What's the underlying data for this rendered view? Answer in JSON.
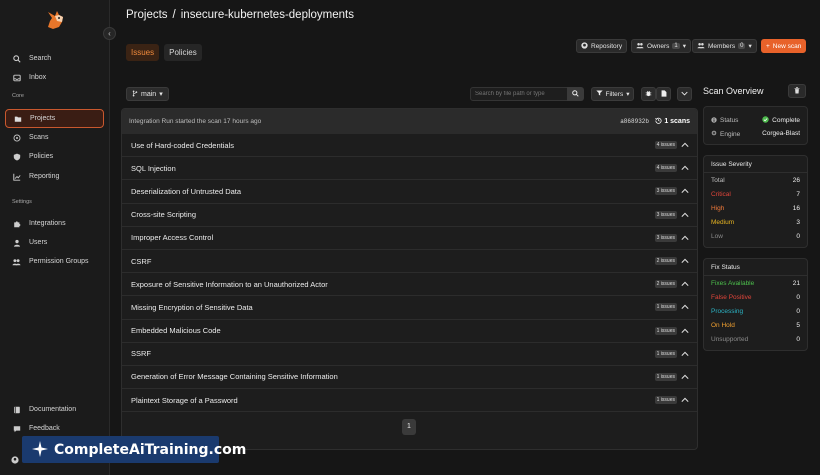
{
  "sidebar": {
    "items_top": [
      {
        "label": "Search",
        "icon": "search-icon"
      },
      {
        "label": "Inbox",
        "icon": "inbox-icon"
      }
    ],
    "section_core": "Core",
    "items_core": [
      {
        "label": "Projects",
        "icon": "folder-icon"
      },
      {
        "label": "Scans",
        "icon": "radar-icon"
      },
      {
        "label": "Policies",
        "icon": "shield-icon"
      },
      {
        "label": "Reporting",
        "icon": "chart-icon"
      }
    ],
    "section_settings": "Settings",
    "items_settings": [
      {
        "label": "Integrations",
        "icon": "puzzle-icon"
      },
      {
        "label": "Users",
        "icon": "user-icon"
      },
      {
        "label": "Permission Groups",
        "icon": "users-icon"
      }
    ],
    "items_bottom": [
      {
        "label": "Documentation",
        "icon": "book-icon"
      },
      {
        "label": "Feedback",
        "icon": "chat-icon"
      }
    ]
  },
  "breadcrumb": {
    "root": "Projects",
    "sep": "/",
    "project": "insecure-kubernetes-deployments"
  },
  "tabs": [
    "Issues",
    "Policies"
  ],
  "header_buttons": {
    "repository": "Repository",
    "owners": "Owners",
    "owners_count": "1",
    "members": "Members",
    "members_count": "0",
    "new_scan": "New scan"
  },
  "toolbar": {
    "branch": "main",
    "search_placeholder": "Search by file path or type",
    "filters": "Filters"
  },
  "scan_info": {
    "message": "Integration Run started the scan 17 hours ago",
    "commit": "a868932b",
    "scans": "1 scans"
  },
  "issues": [
    {
      "title": "Use of Hard-coded Credentials",
      "count": "4 issues"
    },
    {
      "title": "SQL Injection",
      "count": "4 issues"
    },
    {
      "title": "Deserialization of Untrusted Data",
      "count": "3 issues"
    },
    {
      "title": "Cross-site Scripting",
      "count": "3 issues"
    },
    {
      "title": "Improper Access Control",
      "count": "3 issues"
    },
    {
      "title": "CSRF",
      "count": "2 issues"
    },
    {
      "title": "Exposure of Sensitive Information to an Unauthorized Actor",
      "count": "2 issues"
    },
    {
      "title": "Missing Encryption of Sensitive Data",
      "count": "1 issues"
    },
    {
      "title": "Embedded Malicious Code",
      "count": "1 issues"
    },
    {
      "title": "SSRF",
      "count": "1 issues"
    },
    {
      "title": "Generation of Error Message Containing Sensitive Information",
      "count": "1 issues"
    },
    {
      "title": "Plaintext Storage of a Password",
      "count": "1 issues"
    }
  ],
  "pagination": {
    "current": "1"
  },
  "overview": {
    "title": "Scan Overview",
    "status_label": "Status",
    "status_value": "Complete",
    "engine_label": "Engine",
    "engine_value": "Corgea-Blast",
    "severity_title": "Issue Severity",
    "severity": [
      {
        "label": "Total",
        "value": "26",
        "color": "#bdbdbd"
      },
      {
        "label": "Critical",
        "value": "7",
        "color": "#e0453a"
      },
      {
        "label": "High",
        "value": "16",
        "color": "#f07a3a"
      },
      {
        "label": "Medium",
        "value": "3",
        "color": "#e6b422"
      },
      {
        "label": "Low",
        "value": "0",
        "color": "#8a8a8a"
      }
    ],
    "fix_title": "Fix Status",
    "fix": [
      {
        "label": "Fixes Available",
        "value": "21",
        "color": "#4cc04c"
      },
      {
        "label": "False Positive",
        "value": "0",
        "color": "#e0453a"
      },
      {
        "label": "Processing",
        "value": "0",
        "color": "#2bb3c4"
      },
      {
        "label": "On Hold",
        "value": "5",
        "color": "#f0a030"
      },
      {
        "label": "Unsupported",
        "value": "0",
        "color": "#8a8a8a"
      }
    ]
  },
  "watermark": "CompleteAiTraining.com"
}
